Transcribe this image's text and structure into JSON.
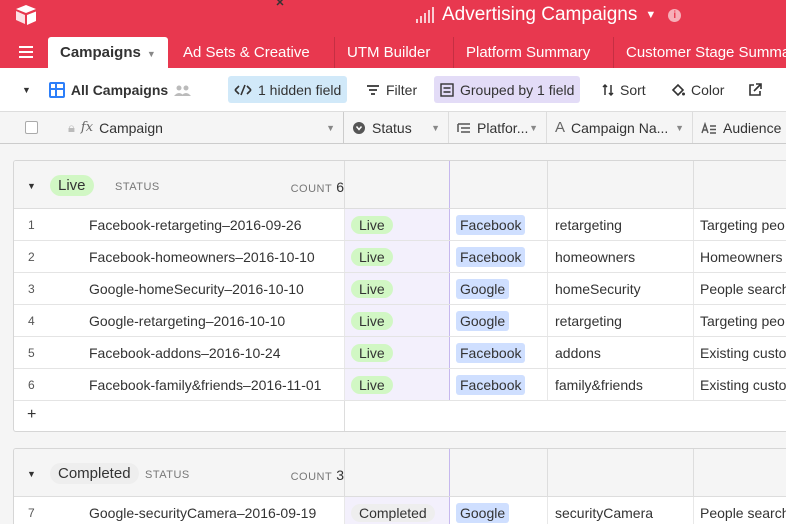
{
  "base": {
    "title": "Advertising Campaigns"
  },
  "tabs": [
    {
      "label": "Campaigns",
      "active": true
    },
    {
      "label": "Ad Sets & Creative"
    },
    {
      "label": "UTM Builder"
    },
    {
      "label": "Platform Summary"
    },
    {
      "label": "Customer Stage Summa"
    }
  ],
  "toolbar": {
    "view_name": "All Campaigns",
    "hidden": "1 hidden field",
    "filter": "Filter",
    "grouped": "Grouped by 1 field",
    "sort": "Sort",
    "color": "Color"
  },
  "columns": {
    "campaign": "Campaign",
    "status": "Status",
    "platform": "Platfor...",
    "campaign_name": "Campaign Na...",
    "audience": "Audience"
  },
  "groups": [
    {
      "value": "Live",
      "field": "STATUS",
      "count_label": "COUNT",
      "count": "6",
      "rows": [
        {
          "num": "1",
          "campaign": "Facebook-retargeting–2016-09-26",
          "status": "Live",
          "platform": "Facebook",
          "name": "retargeting",
          "audience": "Targeting peo"
        },
        {
          "num": "2",
          "campaign": "Facebook-homeowners–2016-10-10",
          "status": "Live",
          "platform": "Facebook",
          "name": "homeowners",
          "audience": "Homeowners i"
        },
        {
          "num": "3",
          "campaign": "Google-homeSecurity–2016-10-10",
          "status": "Live",
          "platform": "Google",
          "name": "homeSecurity",
          "audience": "People search"
        },
        {
          "num": "4",
          "campaign": "Google-retargeting–2016-10-10",
          "status": "Live",
          "platform": "Google",
          "name": "retargeting",
          "audience": "Targeting peo"
        },
        {
          "num": "5",
          "campaign": "Facebook-addons–2016-10-24",
          "status": "Live",
          "platform": "Facebook",
          "name": "addons",
          "audience": "Existing custo"
        },
        {
          "num": "6",
          "campaign": "Facebook-family&friends–2016-11-01",
          "status": "Live",
          "platform": "Facebook",
          "name": "family&friends",
          "audience": "Existing custo"
        }
      ]
    },
    {
      "value": "Completed",
      "field": "STATUS",
      "count_label": "COUNT",
      "count": "3",
      "rows": [
        {
          "num": "7",
          "campaign": "Google-securityCamera–2016-09-19",
          "status": "Completed",
          "platform": "Google",
          "name": "securityCamera",
          "audience": "People search"
        }
      ]
    }
  ],
  "add_row": "+",
  "colors": {
    "brand": "#e8384f",
    "live": "#d1f7c4",
    "platform": "#cfdfff",
    "hidden_field": "#d1e9f9",
    "grouped": "#e3dcf7"
  }
}
